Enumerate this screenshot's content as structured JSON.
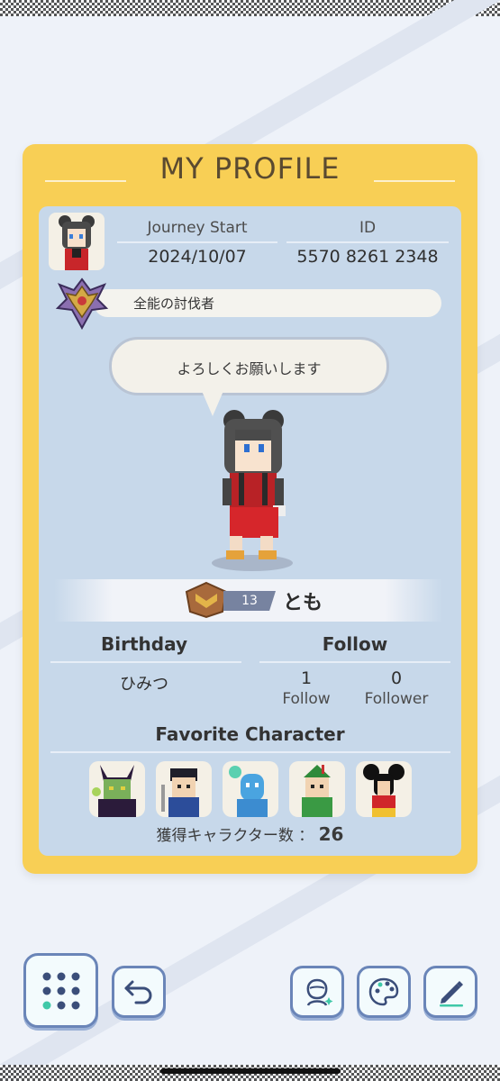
{
  "profile": {
    "title": "MY PROFILE",
    "journey_start_label": "Journey Start",
    "journey_start_value": "2024/10/07",
    "id_label": "ID",
    "id_value": "5570 8261 2348",
    "honor_title": "全能の討伐者",
    "greeting": "よろしくお願いします",
    "level": "13",
    "name": "とも",
    "birthday_label": "Birthday",
    "birthday_value": "ひみつ",
    "follow_label": "Follow",
    "follow_count": "1",
    "follow_count_label": "Follow",
    "follower_count": "0",
    "follower_count_label": "Follower",
    "favorite_label": "Favorite Character",
    "owned_label": "獲得キャラクター数 ：",
    "owned_count": "26"
  },
  "favorites": [
    "Maleficent",
    "Mulan",
    "Genie",
    "Peter Pan",
    "Mickey Mouse"
  ],
  "toolbar": {
    "menu_icon": "grid-menu-icon",
    "back_icon": "back-arrow-icon",
    "avatar_icon": "avatar-edit-icon",
    "palette_icon": "palette-icon",
    "edit_icon": "pencil-icon"
  },
  "colors": {
    "card": "#f8cf55",
    "panel": "#c7d8ea",
    "button_border": "#6a85b8"
  }
}
